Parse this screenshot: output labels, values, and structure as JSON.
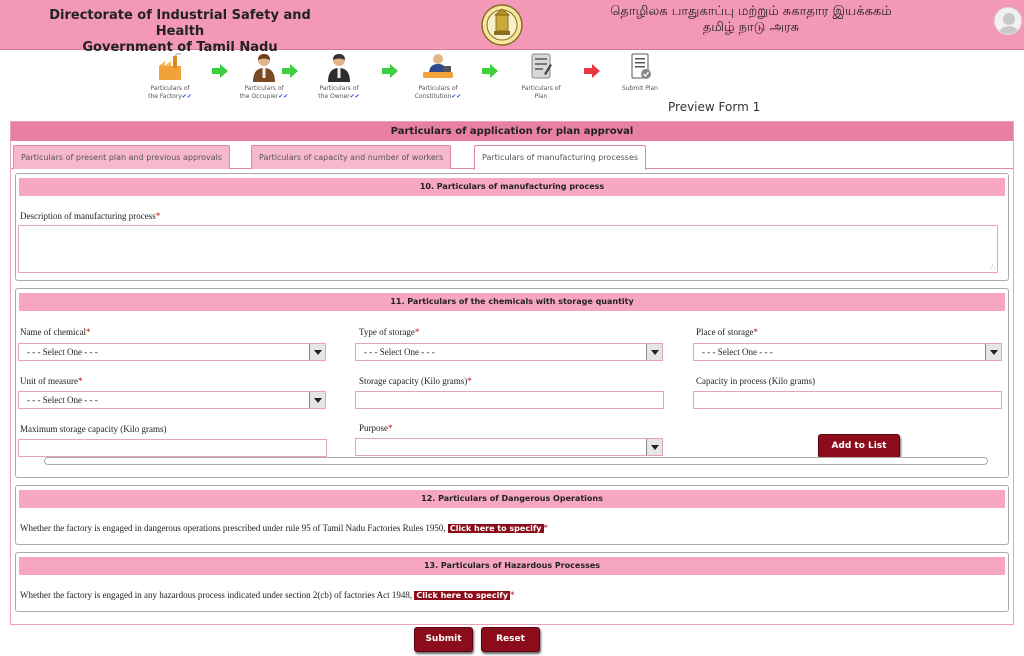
{
  "header": {
    "title_en_line1": "Directorate of Industrial Safety and Health",
    "title_en_line2": "Government of Tamil Nadu",
    "title_ta_line1": "தொழிலக பாதுகாப்பு மற்றும் சுகாதார இயக்ககம்",
    "title_ta_line2": "தமிழ் நாடு அரசு",
    "emblem_icon": "tamil-nadu-emblem-icon",
    "avatar_icon": "user-avatar-icon"
  },
  "steps": [
    {
      "line1": "Particulars of",
      "line2": "the Factory",
      "check": "✔✔",
      "icon": "factory-icon"
    },
    {
      "line1": "Particulars of",
      "line2": "the Occupier",
      "check": "✔✔",
      "icon": "occupier-icon"
    },
    {
      "line1": "Particulars of",
      "line2": "the Owner",
      "check": "✔✔",
      "icon": "owner-icon"
    },
    {
      "line1": "Particulars of",
      "line2": "Constitution",
      "check": "✔✔",
      "icon": "constitution-icon"
    },
    {
      "line1": "Particulars of",
      "line2": "Plan",
      "check": "",
      "icon": "plan-icon"
    },
    {
      "line1": "Submit Plan",
      "line2": "",
      "check": "",
      "icon": "submit-plan-icon"
    }
  ],
  "preview_label": "Preview Form 1",
  "form_title": "Particulars of application for plan approval",
  "tabs": [
    "Particulars of present plan and previous approvals",
    "Particulars of capacity and number of workers",
    "Particulars of manufacturing processes"
  ],
  "sec10": {
    "title": "10. Particulars of manufacturing process",
    "desc_label": "Description of manufacturing process",
    "required": "*"
  },
  "sec11": {
    "title": "11. Particulars of the chemicals with storage quantity",
    "name_label": "Name of chemical",
    "type_label": "Type of storage",
    "place_label": "Place of storage",
    "unit_label": "Unit of measure",
    "storage_cap_label": "Storage capacity (Kilo grams)",
    "process_cap_label": "Capacity in process (Kilo grams)",
    "max_cap_label": "Maximum storage capacity (Kilo grams)",
    "purpose_label": "Purpose",
    "select_placeholder": "- - - Select One - - -",
    "add_button": "Add to List",
    "required": "*"
  },
  "sec12": {
    "title": "12. Particulars of Dangerous Operations",
    "text": "Whether the factory is engaged in dangerous operations prescribed under rule 95 of Tamil Nadu Factories Rules 1950,",
    "link": "Click here to specify",
    "required": "*"
  },
  "sec13": {
    "title": "13. Particulars of Hazardous Processes",
    "text": "Whether the factory is engaged in any hazardous process indicated under section 2(cb) of factories Act 1948,",
    "link": "Click here to specify",
    "required": "*"
  },
  "buttons": {
    "submit": "Submit",
    "reset": "Reset"
  },
  "colors": {
    "header": "#f398b6",
    "button": "#8b0d1c",
    "section_title": "#f7a6c4"
  }
}
